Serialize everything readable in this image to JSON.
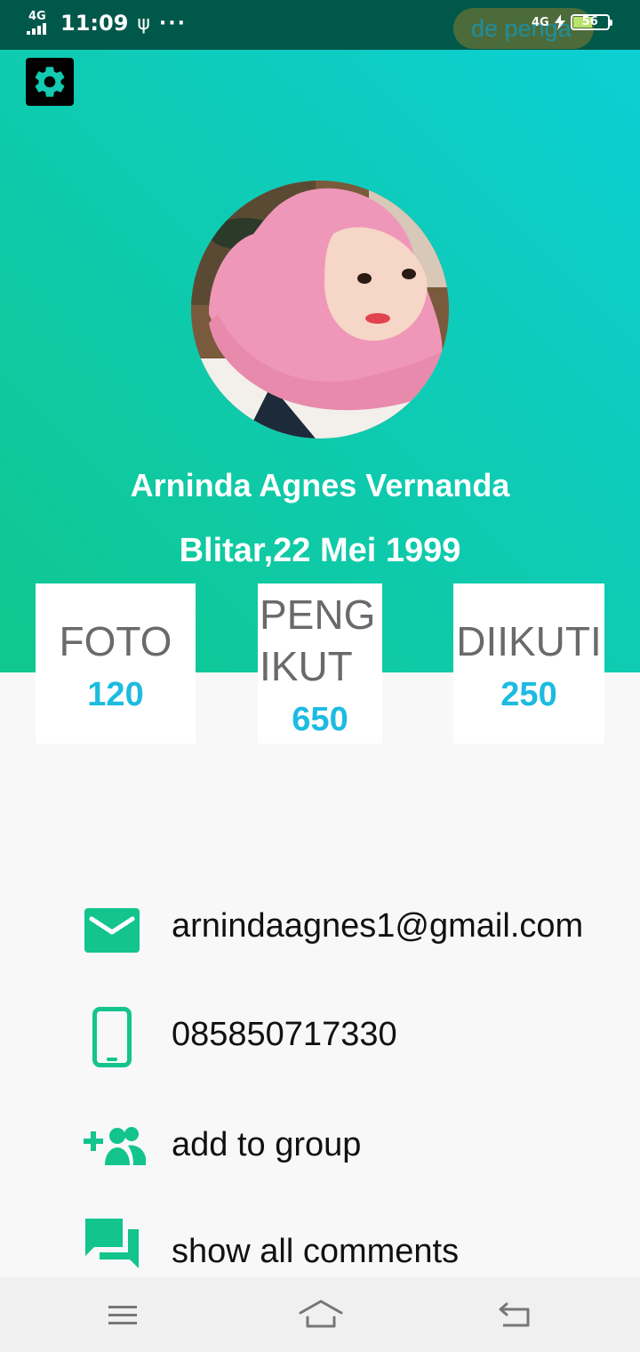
{
  "status_bar": {
    "network": "4G",
    "time": "11:09",
    "usb": "ψ",
    "more": "···",
    "toast_text": "de penga",
    "network_right": "4G",
    "battery": "56"
  },
  "profile": {
    "settings_icon": "gear-icon",
    "name": "Arninda Agnes Vernanda",
    "birth": "Blitar,22 Mei 1999"
  },
  "stats": [
    {
      "label_line1": "FOTO",
      "label_line2": "",
      "value": "120"
    },
    {
      "label_line1": "PENG",
      "label_line2": "IKUT",
      "value": "650"
    },
    {
      "label_line1": "DIIKUTI",
      "label_line2": "",
      "value": "250"
    }
  ],
  "contacts": {
    "email": "arnindaagnes1@gmail.com",
    "phone": "085850717330",
    "group": "add to group",
    "comments": "show all comments"
  },
  "colors": {
    "accent": "#13c48c",
    "stat_value": "#1dbbe0",
    "gradient_start": "#10c78e",
    "gradient_end": "#0ccfd4",
    "status_bar": "#00584b"
  }
}
